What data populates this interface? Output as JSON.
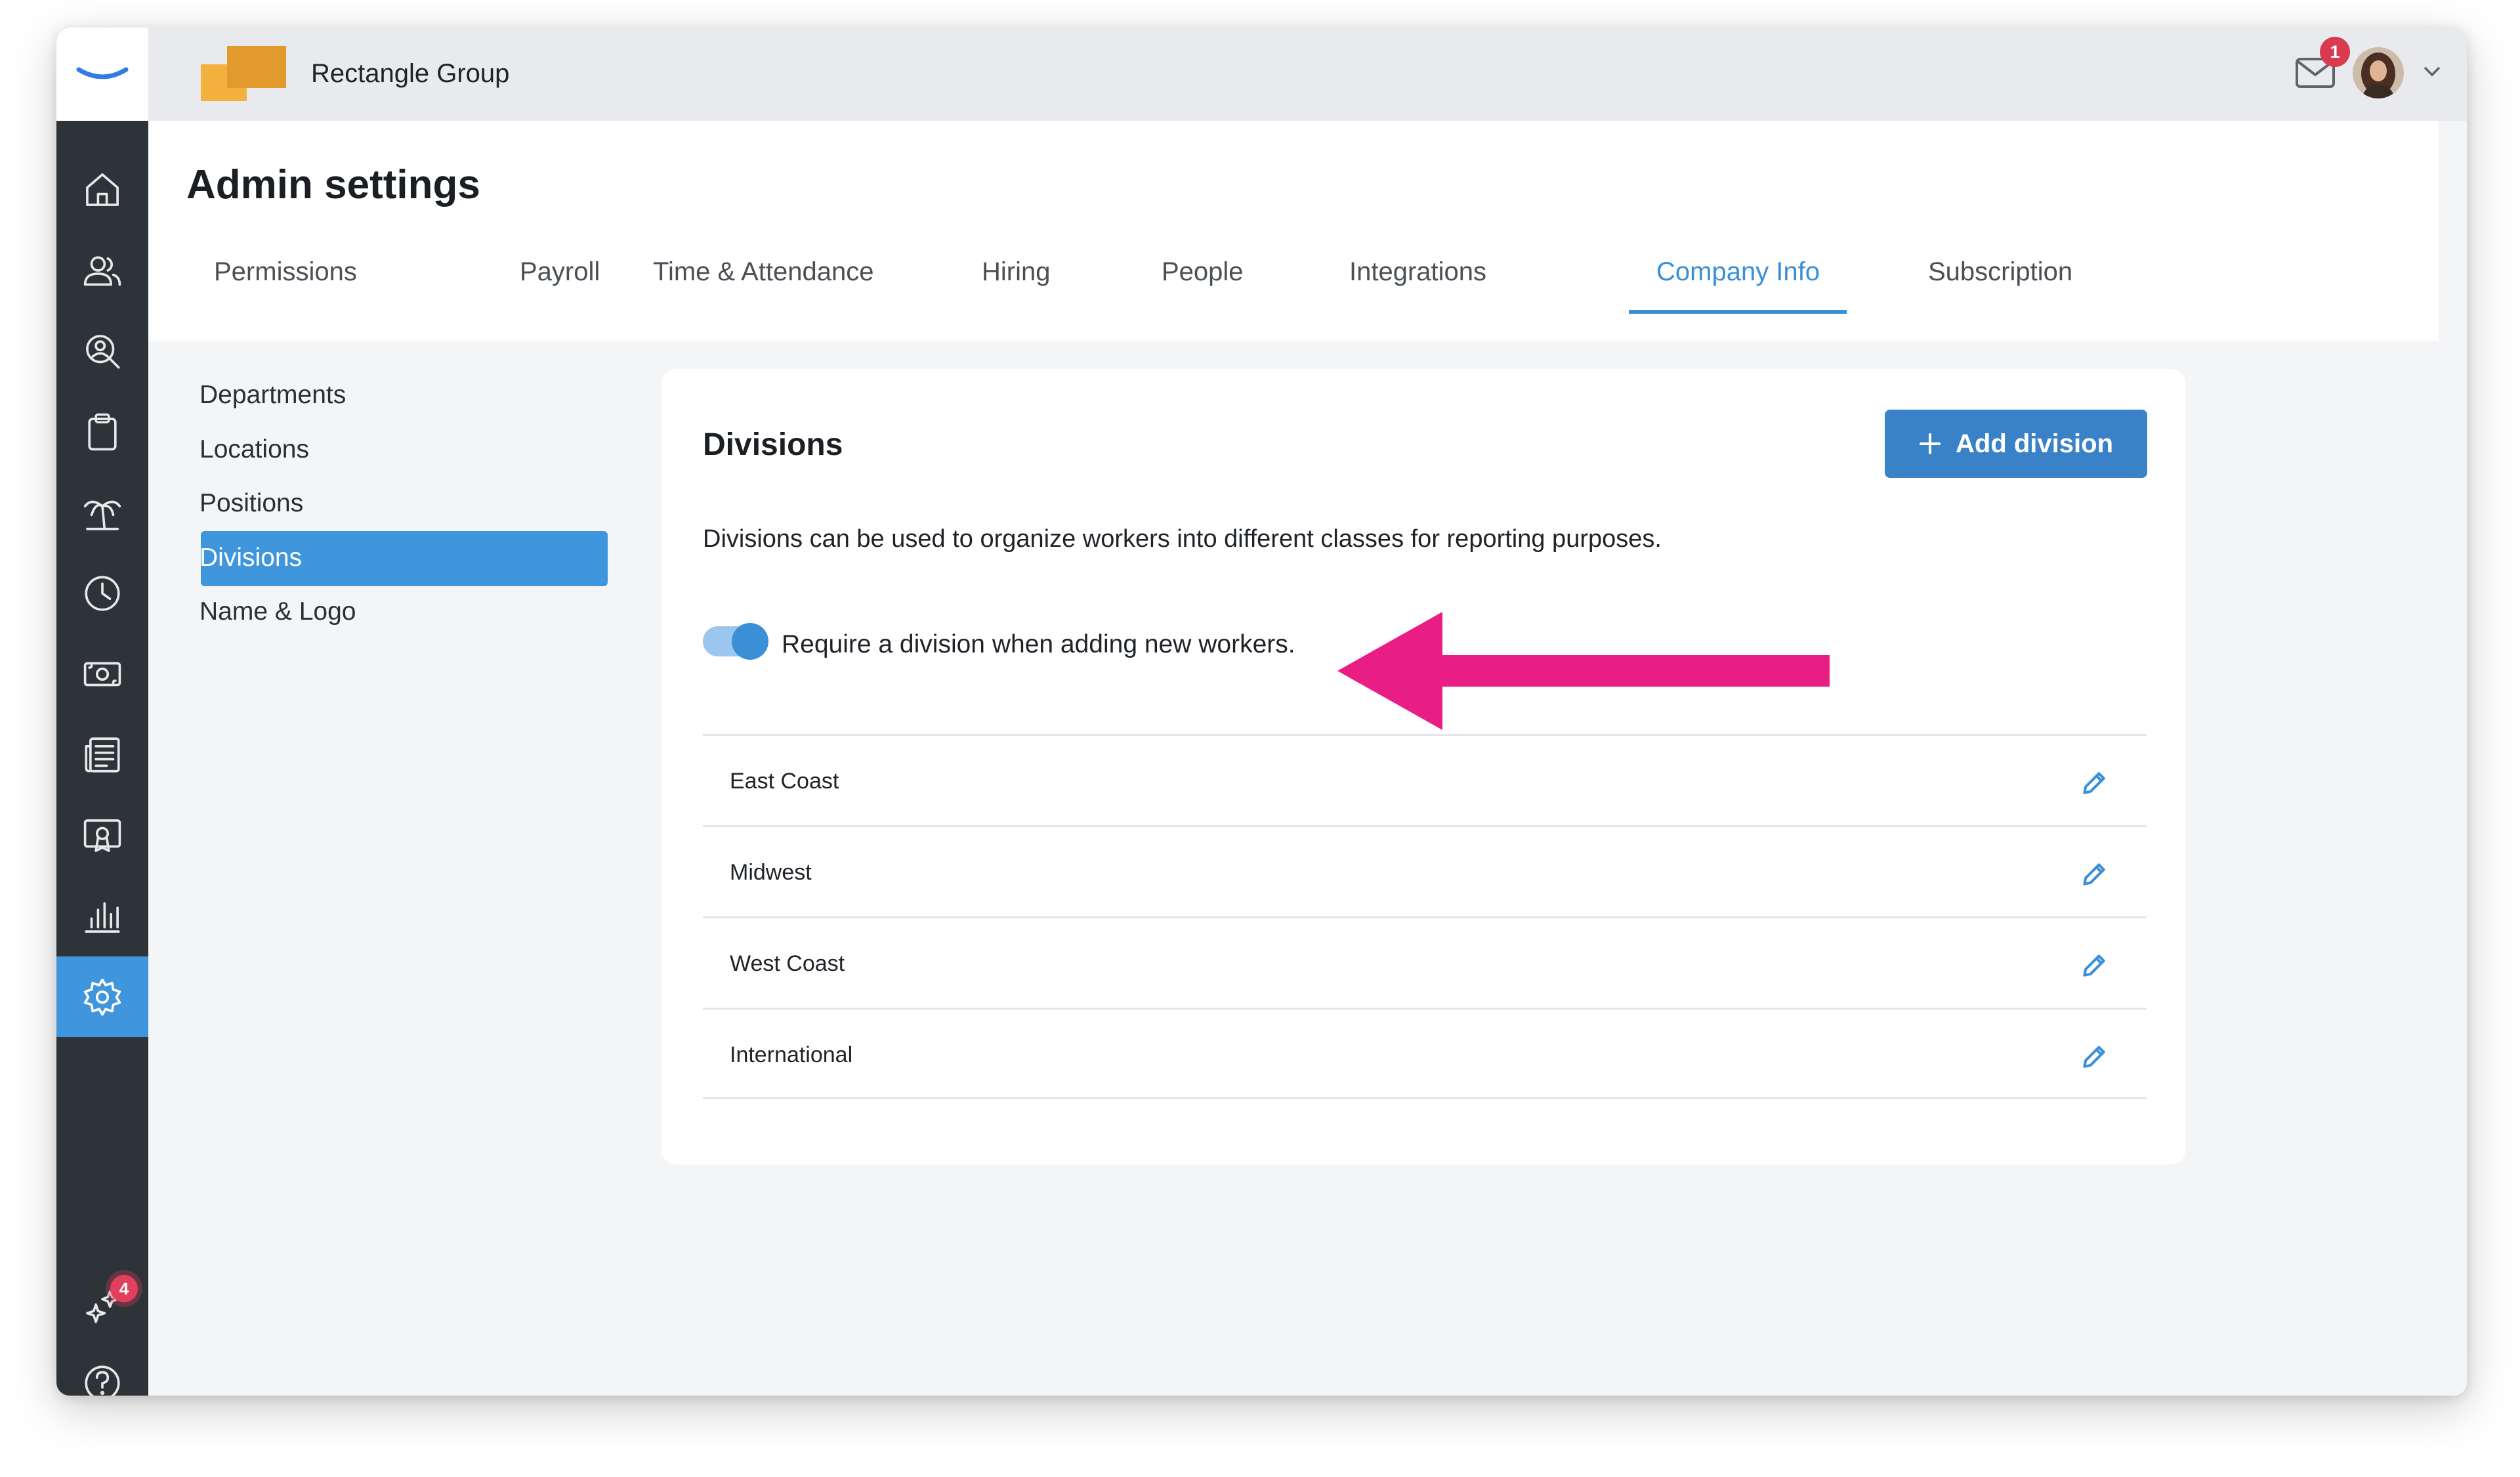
{
  "topbar": {
    "company_name": "Rectangle Group",
    "mail_badge": "1",
    "brand_colors": {
      "orange": "#f5b13d",
      "dark_orange": "#e39a2d"
    }
  },
  "sidebar": {
    "items": [
      {
        "icon": "home-icon"
      },
      {
        "icon": "people-icon"
      },
      {
        "icon": "recruiting-search-icon"
      },
      {
        "icon": "clipboard-icon"
      },
      {
        "icon": "palm-tree-icon"
      },
      {
        "icon": "clock-icon"
      },
      {
        "icon": "money-icon"
      },
      {
        "icon": "newspaper-icon"
      },
      {
        "icon": "certificate-icon"
      },
      {
        "icon": "reports-chart-icon"
      },
      {
        "icon": "settings-gear-icon",
        "active": true
      }
    ],
    "sparkles_badge": "4",
    "help_icon": "help-icon",
    "active_color": "#3f96dc"
  },
  "header": {
    "title": "Admin settings",
    "tabs": [
      {
        "label": "Permissions"
      },
      {
        "label": "Payroll"
      },
      {
        "label": "Time & Attendance"
      },
      {
        "label": "Hiring"
      },
      {
        "label": "People"
      },
      {
        "label": "Integrations"
      },
      {
        "label": "Company Info",
        "active": true
      },
      {
        "label": "Subscription"
      }
    ]
  },
  "subnav": {
    "items": [
      {
        "label": "Departments"
      },
      {
        "label": "Locations"
      },
      {
        "label": "Positions"
      },
      {
        "label": "Divisions",
        "active": true
      },
      {
        "label": "Name & Logo"
      }
    ]
  },
  "card": {
    "title": "Divisions",
    "add_button_label": "Add division",
    "description": "Divisions can be used to organize workers into different classes for reporting purposes.",
    "toggle_label": "Require a division when adding new workers.",
    "toggle_on": true,
    "divisions": [
      {
        "name": "East Coast"
      },
      {
        "name": "Midwest"
      },
      {
        "name": "West Coast"
      },
      {
        "name": "International"
      }
    ]
  },
  "annotation": {
    "arrow_color": "#e91e84"
  }
}
